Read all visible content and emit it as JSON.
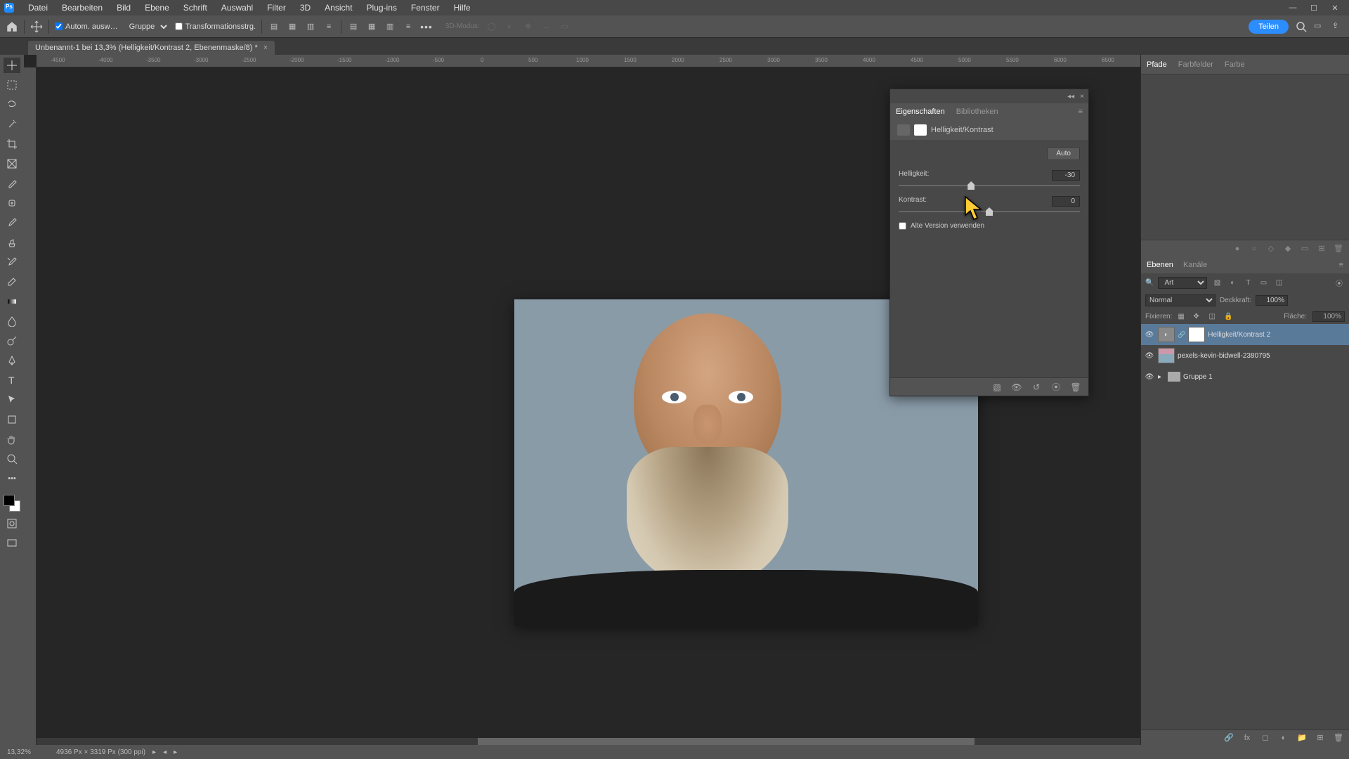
{
  "menu": [
    "Datei",
    "Bearbeiten",
    "Bild",
    "Ebene",
    "Schrift",
    "Auswahl",
    "Filter",
    "3D",
    "Ansicht",
    "Plug-ins",
    "Fenster",
    "Hilfe"
  ],
  "options": {
    "auto_select": "Autom. ausw…",
    "group": "Gruppe",
    "transform": "Transformationsstrg.",
    "mode3d": "3D-Modus:",
    "teilen": "Teilen"
  },
  "document": {
    "tab_title": "Unbenannt-1 bei 13,3% (Helligkeit/Kontrast 2, Ebenenmaske/8) *"
  },
  "ruler": [
    "-4500",
    "-4000",
    "-3500",
    "-3000",
    "-2500",
    "-2000",
    "-1500",
    "-1000",
    "-500",
    "0",
    "500",
    "1000",
    "1500",
    "2000",
    "2500",
    "3000",
    "3500",
    "4000",
    "4500",
    "5000",
    "5500",
    "6000",
    "6500"
  ],
  "right_tabs_top": [
    "Pfade",
    "Farbfelder",
    "Farbe"
  ],
  "layers": {
    "tabs": [
      "Ebenen",
      "Kanäle"
    ],
    "filter_kind": "Art",
    "blend": "Normal",
    "opacity_label": "Deckkraft:",
    "opacity_value": "100%",
    "fill_label": "Fläche:",
    "fill_value": "100%",
    "lock_label": "Fixieren:",
    "rows": [
      {
        "name": "Helligkeit/Kontrast 2",
        "type": "adjustment",
        "selected": true
      },
      {
        "name": "pexels-kevin-bidwell-2380795",
        "type": "image"
      },
      {
        "name": "Gruppe 1",
        "type": "group"
      }
    ]
  },
  "properties": {
    "tabs": [
      "Eigenschaften",
      "Bibliotheken"
    ],
    "title": "Helligkeit/Kontrast",
    "auto": "Auto",
    "brightness_label": "Helligkeit:",
    "brightness_value": "-30",
    "contrast_label": "Kontrast:",
    "contrast_value": "0",
    "legacy": "Alte Version verwenden"
  },
  "status": {
    "zoom": "13,32%",
    "info": "4936 Px × 3319 Px (300 ppi)"
  }
}
